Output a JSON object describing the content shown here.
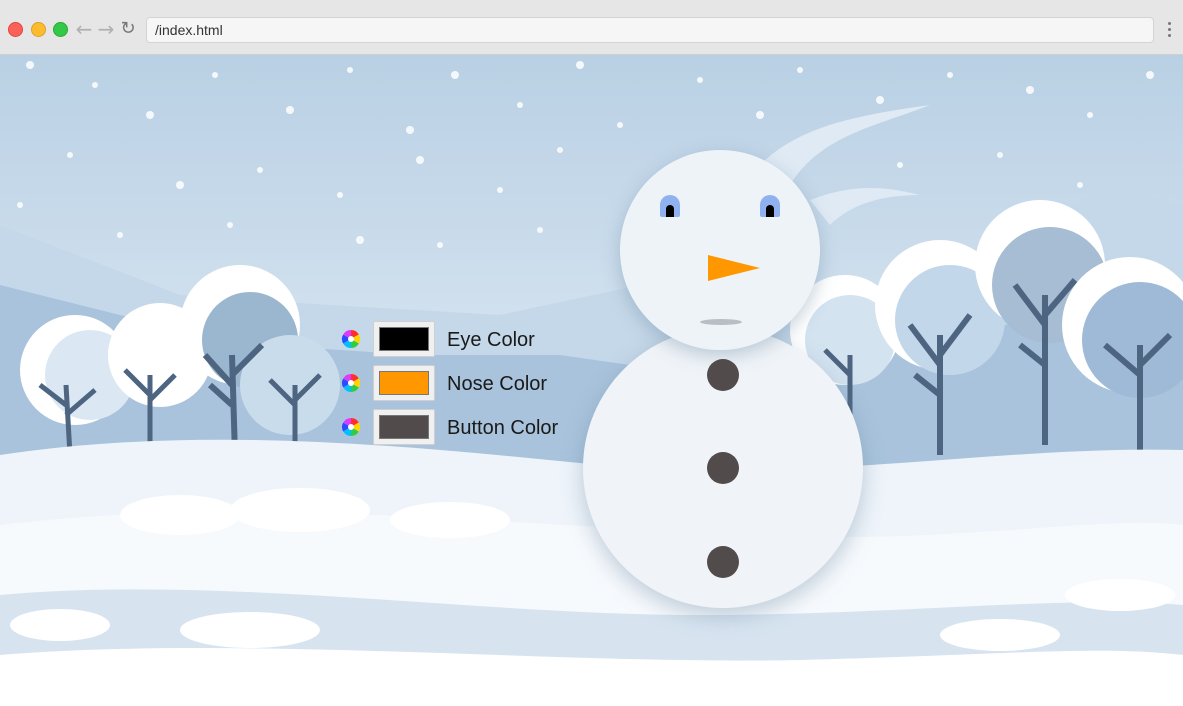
{
  "browser": {
    "url": "/index.html"
  },
  "controls": [
    {
      "label": "Eye Color",
      "color": "#000000"
    },
    {
      "label": "Nose Color",
      "color": "#ff9800"
    },
    {
      "label": "Button Color",
      "color": "#524b4b"
    }
  ],
  "snowman": {
    "eye_color": "#000000",
    "nose_color": "#ff9800",
    "button_color": "#524b4b",
    "eye_white_color": "#8fb1f0"
  },
  "icons": {
    "color_picker": "color-wheel-icon",
    "back": "arrow-left-icon",
    "forward": "arrow-right-icon",
    "reload": "reload-icon",
    "menu": "kebab-menu-icon"
  }
}
